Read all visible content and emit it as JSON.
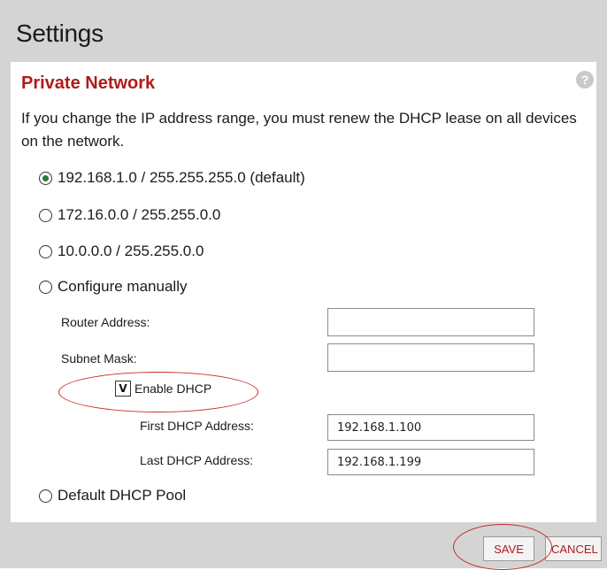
{
  "page": {
    "title": "Settings"
  },
  "section": {
    "title": "Private Network",
    "help_icon": "help-icon",
    "description": "If you change the IP address range, you must renew the DHCP lease on all devices on the network."
  },
  "options": {
    "items": [
      {
        "label": "192.168.1.0 / 255.255.255.0 (default)",
        "checked": true
      },
      {
        "label": "172.16.0.0 / 255.255.0.0",
        "checked": false
      },
      {
        "label": "10.0.0.0 / 255.255.0.0",
        "checked": false
      },
      {
        "label": "Configure manually",
        "checked": false
      }
    ],
    "default_pool": {
      "label": "Default DHCP Pool",
      "checked": false
    }
  },
  "manual": {
    "router_label": "Router Address:",
    "router_value": "",
    "subnet_label": "Subnet Mask:",
    "subnet_value": "",
    "dhcp": {
      "checkbox_glyph": "V",
      "label": "Enable DHCP",
      "checked": true
    },
    "first_label": "First DHCP Address:",
    "first_value": "192.168.1.100",
    "last_label": "Last DHCP Address:",
    "last_value": "192.168.1.199"
  },
  "actions": {
    "save": "SAVE",
    "cancel": "CANCEL"
  },
  "colors": {
    "accent": "#b01b1b",
    "annotation": "#cc2b2b",
    "frame": "#d4d4d4"
  }
}
